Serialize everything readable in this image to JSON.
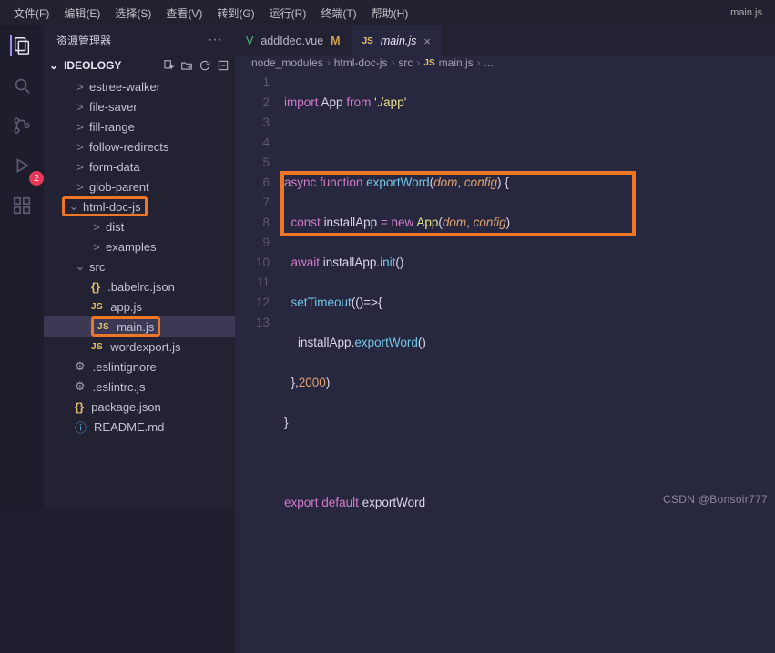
{
  "menubar": {
    "items": [
      "文件(F)",
      "编辑(E)",
      "选择(S)",
      "查看(V)",
      "转到(G)",
      "运行(R)",
      "终端(T)",
      "帮助(H)"
    ],
    "right": "main.js"
  },
  "activity": {
    "badge": "2"
  },
  "sidebar": {
    "title": "资源管理器",
    "folder": "IDEOLOGY",
    "tree": {
      "items": [
        {
          "lvl": "l1",
          "arrow": ">",
          "name": "estree-walker"
        },
        {
          "lvl": "l1",
          "arrow": ">",
          "name": "file-saver"
        },
        {
          "lvl": "l1",
          "arrow": ">",
          "name": "fill-range"
        },
        {
          "lvl": "l1",
          "arrow": ">",
          "name": "follow-redirects"
        },
        {
          "lvl": "l1",
          "arrow": ">",
          "name": "form-data"
        },
        {
          "lvl": "l1",
          "arrow": ">",
          "name": "glob-parent"
        }
      ],
      "html_doc_js": "html-doc-js",
      "under": [
        {
          "lvl": "l2",
          "arrow": ">",
          "name": "dist"
        },
        {
          "lvl": "l2",
          "arrow": ">",
          "name": "examples"
        }
      ],
      "src": "src",
      "files": [
        {
          "icon": "brace",
          "name": ".babelrc.json"
        },
        {
          "icon": "js",
          "name": "app.js"
        }
      ],
      "main_js": "main.js",
      "files2": [
        {
          "icon": "js",
          "name": "wordexport.js"
        },
        {
          "icon": "gear",
          "name": ".eslintignore"
        },
        {
          "icon": "gear",
          "name": ".eslintrc.js"
        },
        {
          "icon": "brace",
          "name": "package.json"
        },
        {
          "icon": "info",
          "name": "README.md"
        }
      ]
    }
  },
  "tabs": {
    "t0": {
      "icon": "V",
      "label": "addIdeo.vue",
      "mod": "M"
    },
    "t1": {
      "icon": "JS",
      "label": "main.js",
      "close": "×"
    }
  },
  "breadcrumb": {
    "p0": "node_modules",
    "p1": "html-doc-js",
    "p2": "src",
    "p3_ic": "JS",
    "p3": "main.js",
    "p4": "..."
  },
  "code": {
    "lines": [
      "1",
      "2",
      "3",
      "4",
      "5",
      "6",
      "7",
      "8",
      "9",
      "10",
      "11",
      "12",
      "13"
    ],
    "k_import": "import",
    "id_App": "App",
    "k_from": "from",
    "str_app": "'./app'",
    "k_async": "async",
    "k_function": "function",
    "fn_exportWord": "exportWord",
    "p_dom": "dom",
    "p_config": "config",
    "k_const": "const",
    "id_installApp": "installApp",
    "op_eq": "=",
    "k_new": "new",
    "cls_App": "App",
    "k_await": "await",
    "fn_init": "init",
    "fn_setTimeout": "setTimeout",
    "arrow": "()=>",
    "fn_export": "exportWord",
    "num_2000": "2000",
    "k_export": "export",
    "k_default": "default"
  },
  "watermark": "CSDN @Bonsoir777"
}
